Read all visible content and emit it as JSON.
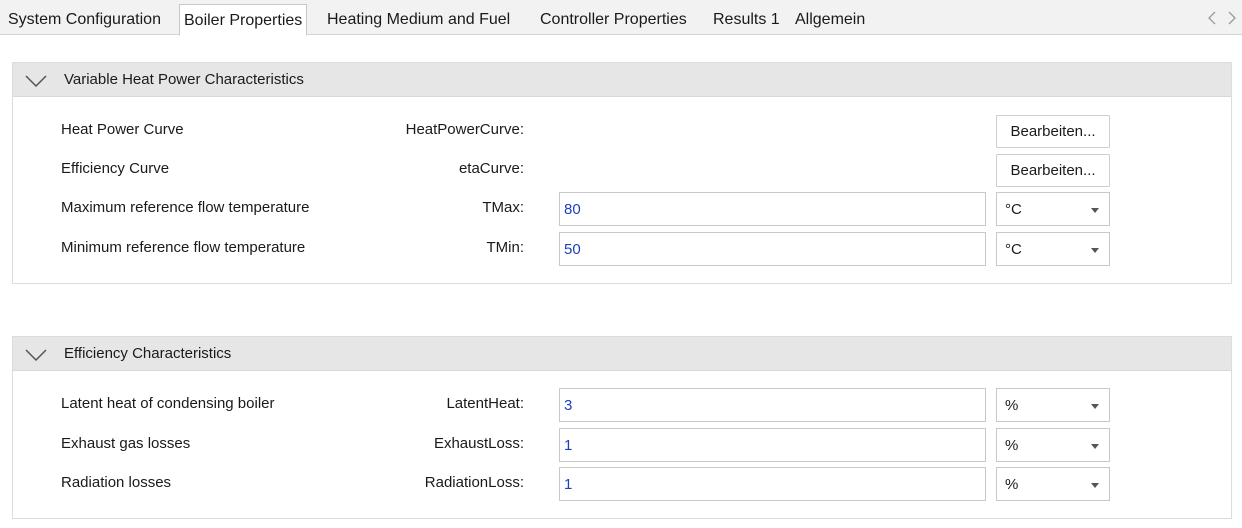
{
  "tabs": [
    {
      "label": "System Configuration"
    },
    {
      "label": "Boiler Properties",
      "active": true
    },
    {
      "label": "Heating Medium and Fuel"
    },
    {
      "label": "Controller Properties"
    },
    {
      "label": "Results 1"
    },
    {
      "label": "Allgemein"
    }
  ],
  "tab_scroll": {
    "left_icon": "chevron-left-icon",
    "right_icon": "chevron-right-icon"
  },
  "sections": [
    {
      "title": "Variable Heat Power Characteristics",
      "expanded": true,
      "rows": [
        {
          "label": "Heat Power Curve",
          "variable": "HeatPowerCurve:",
          "button": "Bearbeiten..."
        },
        {
          "label": "Efficiency Curve",
          "variable": "etaCurve:",
          "button": "Bearbeiten..."
        },
        {
          "label": "Maximum reference flow temperature",
          "variable": "TMax:",
          "value": "80",
          "unit": "°C"
        },
        {
          "label": "Minimum reference flow temperature",
          "variable": "TMin:",
          "value": "50",
          "unit": "°C"
        }
      ]
    },
    {
      "title": "Efficiency Characteristics",
      "expanded": true,
      "rows": [
        {
          "label": "Latent heat of condensing boiler",
          "variable": "LatentHeat:",
          "value": "3",
          "unit": "%"
        },
        {
          "label": "Exhaust gas losses",
          "variable": "ExhaustLoss:",
          "value": "1",
          "unit": "%"
        },
        {
          "label": "Radiation losses",
          "variable": "RadiationLoss:",
          "value": "1",
          "unit": "%"
        }
      ]
    }
  ],
  "colors": {
    "value_text": "#1f3fbf",
    "header_bg": "#e6e6e6",
    "tabbar_bg": "#f2f2f2"
  }
}
